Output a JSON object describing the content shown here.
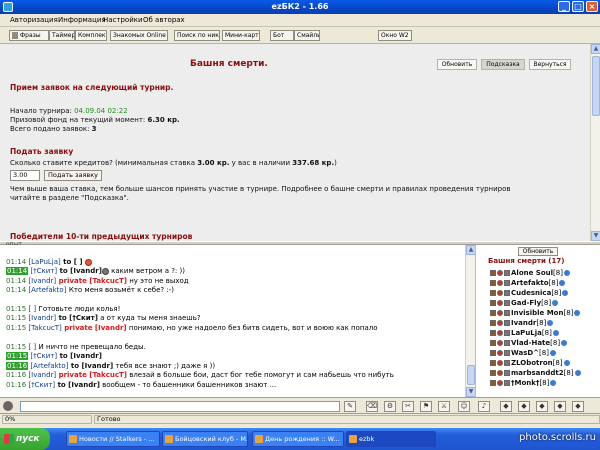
{
  "window": {
    "title": "ezБК2 - 1.66"
  },
  "menu": [
    "Авторизация",
    "Информация",
    "Настройки",
    "Об авторах"
  ],
  "toolbar": [
    "Фразы",
    "Таймер",
    "Комплект",
    "Знакомых Online -",
    "Поиск по нику",
    "Мини-карта",
    "Бот",
    "Смайлы",
    "Окно W2"
  ],
  "page": {
    "title": "Башня смерти.",
    "buttons": [
      "Обновить",
      "Подсказка",
      "Вернуться"
    ],
    "section1": "Прием заявок на следующий турнир.",
    "start_label": "Начало турнира:",
    "start_value": "04.09.04 02:22",
    "prize_label": "Призовой фонд на текущий момент:",
    "prize_value": "6.30 кр.",
    "apps_label": "Всего подано заявок:",
    "apps_value": "3",
    "section2": "Подать заявку",
    "stake_q": "Сколько ставите кредитов? (минимальная ставка",
    "stake_min": "3.00 кр.",
    "stake_mid": "у вас в наличии",
    "stake_have": "337.68 кр.",
    "stake_end": ")",
    "amount_value": "3.00",
    "submit_label": "Подать заявку",
    "info1": "Чем выше ваша ставка, тем больше шансов принять участие в турнире. Подробнее о башне смерти и правилах проведения турниров",
    "info2": "читайте в разделе \"Подсказка\".",
    "section3": "Победители 10-ти предыдущих турниров"
  },
  "splitter_label": "опыт",
  "chat": [
    {
      "time": "01:14",
      "hl": false,
      "nick": "[LaPuLja]",
      "to": " to ",
      "target": "[ ]",
      "text": "",
      "private": false
    },
    {
      "time": "01:14",
      "hl": true,
      "nick": "[†Скит]",
      "to": " to ",
      "target": "[Ivandr]",
      "text": " каким ветром а ?: ))",
      "private": false
    },
    {
      "time": "01:14",
      "hl": false,
      "nick": "[Ivandr]",
      "to": " private ",
      "target": "[TakcucT]",
      "text": " ну это не выход",
      "private": true
    },
    {
      "time": "01:14",
      "hl": false,
      "nick": "[Artefakto]",
      "to": " ",
      "target": "",
      "text": "Кто меня возьмёт к себе? :-)",
      "private": false
    },
    {
      "time": "01:15",
      "hl": false,
      "nick": "[ ]",
      "to": " ",
      "target": "",
      "text": "Готовьте люди колья!",
      "private": false
    },
    {
      "time": "01:15",
      "hl": false,
      "nick": "[Ivandr]",
      "to": " to ",
      "target": "[†Скит]",
      "text": " а от куда ты меня знаешь?",
      "private": false
    },
    {
      "time": "01:15",
      "hl": false,
      "nick": "[TakcucT]",
      "to": " private ",
      "target": "[Ivandr]",
      "text": " понимаю, но уже надоело без битв сидеть, вот и воюю как попало",
      "private": true
    },
    {
      "time": "01:15",
      "hl": false,
      "nick": "[ ]",
      "to": " ",
      "target": "",
      "text": "И ничто не превещало беды.",
      "private": false
    },
    {
      "time": "01:15",
      "hl": true,
      "nick": "[†Скит]",
      "to": " to ",
      "target": "[Ivandr]",
      "text": "",
      "private": false
    },
    {
      "time": "01:16",
      "hl": true,
      "nick": "[Artefakto]",
      "to": " to ",
      "target": "[Ivandr]",
      "text": " тебя все знают ;) даже я ))",
      "private": false
    },
    {
      "time": "01:16",
      "hl": false,
      "nick": "[Ivandr]",
      "to": " private ",
      "target": "[TakcucT]",
      "text": " влезай в больше бои, даст бог тебе помогут и сам набьешь что нибуть",
      "private": true
    },
    {
      "time": "01:16",
      "hl": false,
      "nick": "[†Скит]",
      "to": " to ",
      "target": "[Ivandr]",
      "text": " вообщем - то башенники башенников знают ...",
      "private": false
    }
  ],
  "online": {
    "refresh": "Обновить",
    "header": "Башня смерти (17)",
    "users": [
      {
        "name": "Alone Soul",
        "level": "[8]"
      },
      {
        "name": "Artefakto",
        "level": "[8]"
      },
      {
        "name": "Cudesnica",
        "level": "[8]"
      },
      {
        "name": "Gad-Fly",
        "level": "[8]"
      },
      {
        "name": "Invisible Mon",
        "level": "[8]"
      },
      {
        "name": "Ivandr",
        "level": "[8]"
      },
      {
        "name": "LaPuLja",
        "level": "[8]"
      },
      {
        "name": "Vlad-Hate",
        "level": "[8]"
      },
      {
        "name": "WasD^",
        "level": "[8]"
      },
      {
        "name": "ZLObotron",
        "level": "[8]"
      },
      {
        "name": "marbsanddt2",
        "level": "[8]"
      },
      {
        "name": "†Monk†",
        "level": "[8]"
      }
    ]
  },
  "status": {
    "percent": "0%",
    "ready": "Готово"
  },
  "taskbar": {
    "start": "пуск",
    "tasks": [
      "Новости // Stalkers - ...",
      "Бойцовский клуб - M...",
      "День рождения :: W...",
      "ezbk"
    ]
  },
  "watermark": "photo.scrolls.ru"
}
